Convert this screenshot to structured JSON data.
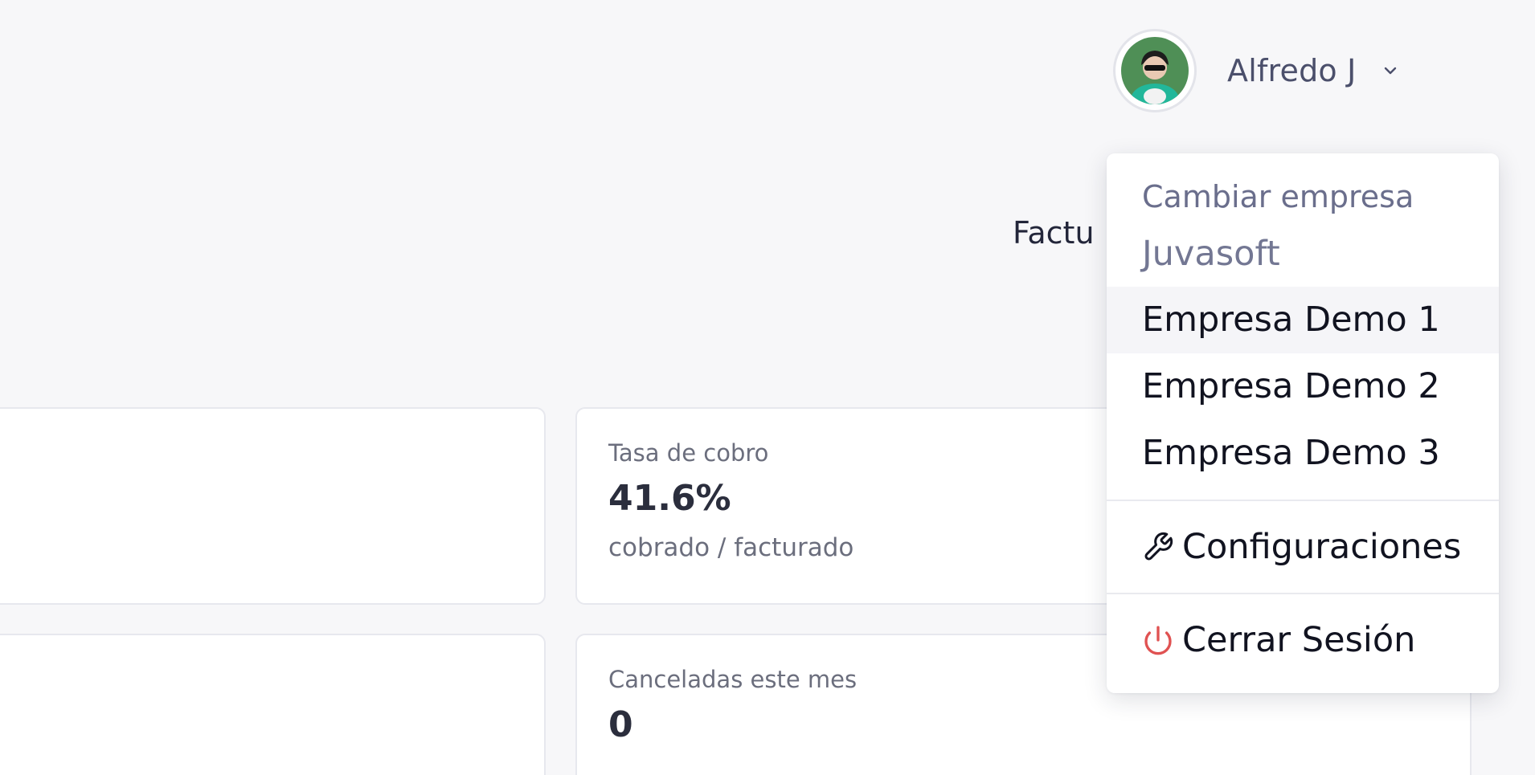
{
  "header": {
    "user_name": "Alfredo J",
    "section_title_fragment": "Factu"
  },
  "kpis": [
    {
      "label": "Tasa de cobro",
      "value": "41.6%",
      "sub": "cobrado / facturado"
    },
    {
      "label": "Canceladas este mes",
      "value": "0",
      "sub": ""
    }
  ],
  "dropdown": {
    "header": "Cambiar empresa",
    "current_company": "Juvasoft",
    "companies": [
      "Empresa Demo 1",
      "Empresa Demo 2",
      "Empresa Demo 3"
    ],
    "settings_label": "Configuraciones",
    "logout_label": "Cerrar Sesión",
    "logout_icon_color": "#e05252"
  }
}
